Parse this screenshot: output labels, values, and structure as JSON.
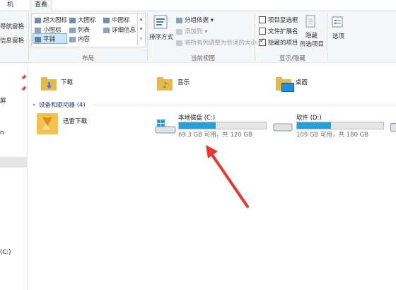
{
  "tabs": [
    "机",
    "查看"
  ],
  "ribbon": {
    "left_partial": [
      "导航窗格",
      "信息窗格"
    ],
    "layout_items": [
      "超大图标",
      "大图标",
      "中图标",
      "小图标",
      "列表",
      "详细信息",
      "平铺",
      "内容"
    ],
    "layout_label": "布局",
    "sort_label": "排序方式",
    "group_by": "分组依据",
    "add_column": "添加列",
    "size_all_columns": "将所有列调整为合适的大小",
    "current_view_label": "当前视图",
    "checkboxes": [
      {
        "label": "项目复选框",
        "checked": false
      },
      {
        "label": "文件扩展名",
        "checked": false
      },
      {
        "label": "隐藏的项目",
        "checked": true
      }
    ],
    "hide_label": "隐藏",
    "hide_sub": "所选项目",
    "show_hide_label": "显示/隐藏",
    "options_label": "选项"
  },
  "sidebar": {
    "items": [
      "屏",
      "n",
      "(C:)"
    ]
  },
  "folders": [
    "下载",
    "音乐",
    "桌面"
  ],
  "devices_header": "设备和驱动器 (4)",
  "devices": {
    "xunlei": "迅雷下载",
    "drives": [
      {
        "name": "本地磁盘 (C:)",
        "space": "69.3 GB 可用，共 120 GB",
        "used_fraction": 0.42
      },
      {
        "name": "软件 (D:)",
        "space": "109 GB 可用，共 180 GB",
        "used_fraction": 0.39
      }
    ]
  },
  "colors": {
    "accent": "#26a0da",
    "arrow": "#e8372c",
    "folder": "#e8b84a"
  }
}
